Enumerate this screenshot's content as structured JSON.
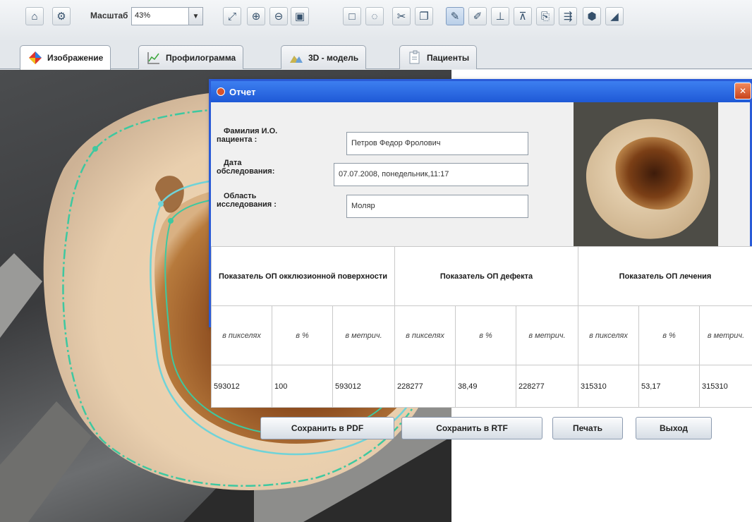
{
  "toolbar": {
    "zoom_label": "Масштаб",
    "zoom_value": "43%",
    "icons": [
      "open-icon",
      "settings-icon",
      "fit-icon",
      "zoom-in-icon",
      "zoom-out-icon",
      "zoom-reset-icon",
      "rect-select-icon",
      "lasso-icon",
      "cut-icon",
      "copy-icon",
      "draw-contour-icon",
      "contour-edit-icon",
      "measure-icon",
      "measure-area-icon",
      "export-icon",
      "export-all-icon",
      "color-icon",
      "eraser-icon"
    ]
  },
  "tabs": [
    {
      "label": "Изображение",
      "active": true
    },
    {
      "label": "Профилограмма",
      "active": false
    },
    {
      "label": "3D - модель",
      "active": false
    },
    {
      "label": "Пациенты",
      "active": false
    }
  ],
  "dialog": {
    "title": "Отчет",
    "fields": [
      {
        "label_line1": "Фамилия И.О.",
        "label_line2": "пациента :",
        "value": "Петров Федор Фролович"
      },
      {
        "label_line1": "Дата",
        "label_line2": "обследования:",
        "value": "07.07.2008, понедельник,11:17"
      },
      {
        "label_line1": "Область",
        "label_line2": "исследования :",
        "value": "Моляр"
      }
    ],
    "table": {
      "groups": [
        "Показатель ОП окклюзионной поверхности",
        "Показатель ОП дефекта",
        "Показатель ОП лечения"
      ],
      "units": [
        "в пикселях",
        "в %",
        "в метрич."
      ],
      "values": [
        "593012",
        "100",
        "593012",
        "228277",
        "38,49",
        "228277",
        "315310",
        "53,17",
        "315310"
      ]
    },
    "buttons": {
      "pdf": "Сохранить в PDF",
      "rtf": "Сохранить в RTF",
      "print": "Печать",
      "exit": "Выход"
    }
  },
  "colors": {
    "title_bar": "#2a5bd7",
    "contour": "#3ec8a0",
    "contour_inner": "#6fd3d8"
  }
}
